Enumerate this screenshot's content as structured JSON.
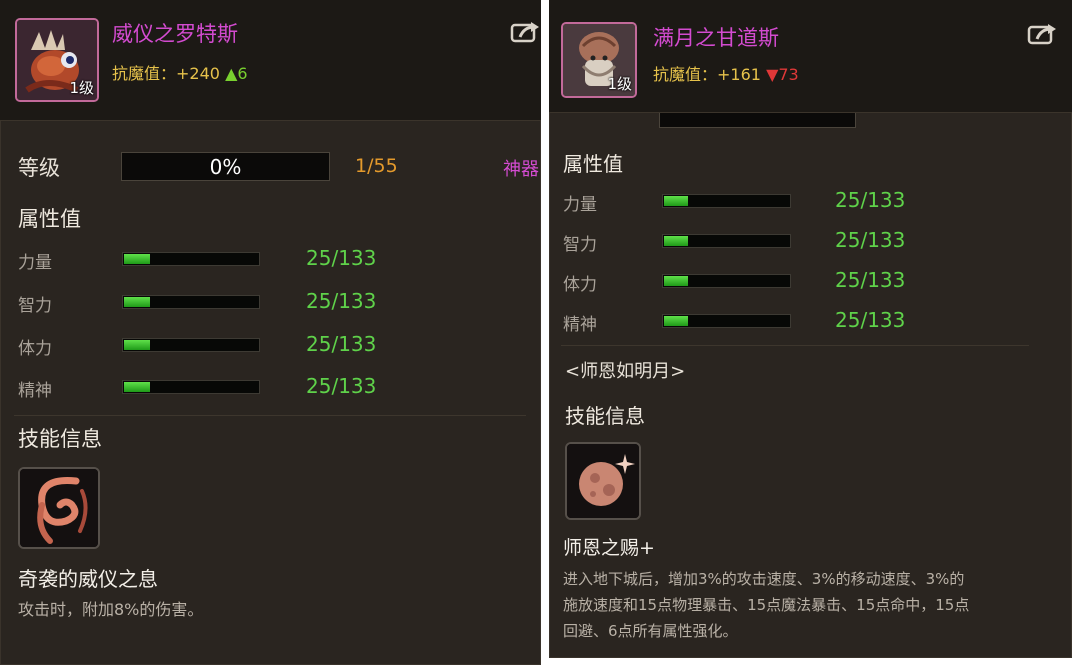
{
  "left": {
    "name": "威仪之罗特斯",
    "level_badge": "1级",
    "resist_label": "抗魔值：",
    "resist_value": "+240",
    "resist_delta": "▲6",
    "grade_label": "等级",
    "grade_percent": "0%",
    "grade_progress": 0,
    "grade_count": "1/55",
    "artifact_tag": "神器",
    "attr_title": "属性值",
    "stats": [
      {
        "name": "力量",
        "value": "25/133",
        "fill": 0.188
      },
      {
        "name": "智力",
        "value": "25/133",
        "fill": 0.188
      },
      {
        "name": "体力",
        "value": "25/133",
        "fill": 0.188
      },
      {
        "name": "精神",
        "value": "25/133",
        "fill": 0.188
      }
    ],
    "skill_title": "技能信息",
    "skill_name": "奇袭的威仪之息",
    "skill_desc": "攻击时，附加8%的伤害。"
  },
  "right": {
    "name": "满月之甘道斯",
    "level_badge": "1级",
    "resist_label": "抗魔值：",
    "resist_value": "+161",
    "resist_delta": "▼73",
    "attr_title": "属性值",
    "stats": [
      {
        "name": "力量",
        "value": "25/133",
        "fill": 0.188
      },
      {
        "name": "智力",
        "value": "25/133",
        "fill": 0.188
      },
      {
        "name": "体力",
        "value": "25/133",
        "fill": 0.188
      },
      {
        "name": "精神",
        "value": "25/133",
        "fill": 0.188
      }
    ],
    "set_name": "<师恩如明月>",
    "skill_title": "技能信息",
    "skill_name": "师恩之赐+",
    "skill_desc_lines": [
      "进入地下城后，增加3%的攻击速度、3%的移动速度、3%的",
      "施放速度和15点物理暴击、15点魔法暴击、15点命中，15点",
      "回避、6点所有属性强化。"
    ]
  },
  "colors": {
    "name": "#d34bd0",
    "resist": "#e6c24b",
    "up": "#79d12f",
    "down": "#e03838",
    "stat_value": "#5fd24a",
    "grade_count": "#e49a2c"
  }
}
